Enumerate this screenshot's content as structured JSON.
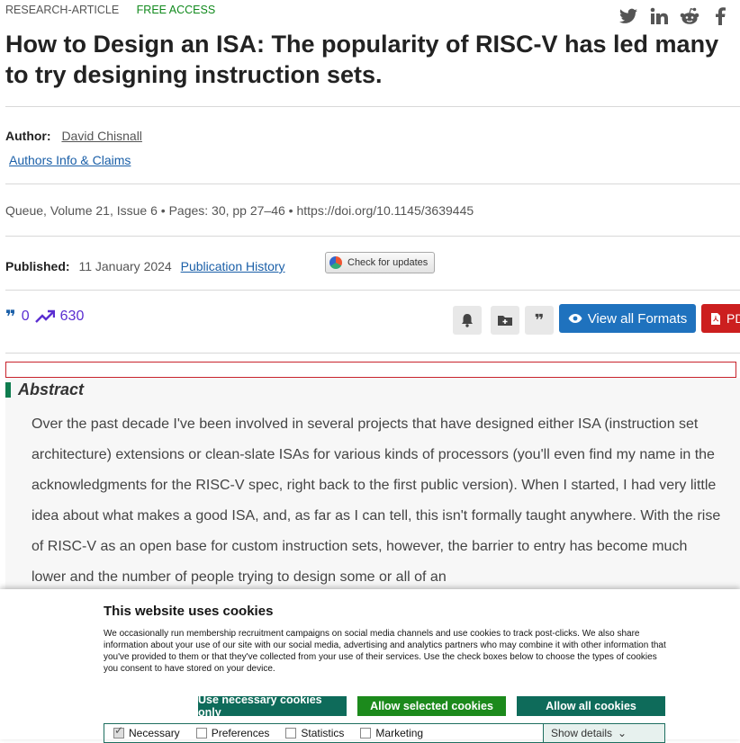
{
  "header": {
    "article_type": "RESEARCH-ARTICLE",
    "access": "FREE ACCESS",
    "share_icons": [
      "twitter-icon",
      "linkedin-icon",
      "reddit-icon",
      "facebook-icon"
    ]
  },
  "article": {
    "title_line1": "How to Design an ISA: The popularity of RISC-V has led many",
    "title_line2": "to try designing instruction sets.",
    "author_label": "Author:",
    "author_name": "David Chisnall",
    "authors_info": "Authors Info & Claims",
    "meta": "Queue, Volume 21, Issue 6 • Pages: 30, pp 27–46 • https://doi.org/10.1145/3639445",
    "published_label": "Published:",
    "published_date": "11 January 2024",
    "publication_history": "Publication History",
    "check_updates": "Check for updates",
    "citations": "0",
    "downloads": "630",
    "view_formats": "View all Formats",
    "pdf": "PDF"
  },
  "abstract": {
    "heading": "Abstract",
    "text": "Over the past decade I've been involved in several projects that have designed either ISA (instruction set architecture) extensions or clean-slate ISAs for various kinds of processors (you'll even find my name in the acknowledgments for the RISC-V spec, right back to the first public version). When I started, I had very little idea about what makes a good ISA, and, as far as I can tell, this isn't formally taught anywhere. With the rise of RISC-V as an open base for custom instruction sets, however, the barrier to entry has become much lower and the number of people trying to design some or all of an"
  },
  "cookie": {
    "title": "This website uses cookies",
    "body": "We occasionally run membership recruitment campaigns on social media channels and use cookies to track post-clicks. We also share information about your use of our site with our social media, advertising and analytics partners who may combine it with other information that you've provided to them or that they've collected from your use of their services. Use the check boxes below to choose the types of cookies you consent to have stored on your device.",
    "btn_necessary": "Use necessary cookies only",
    "btn_selected": "Allow selected cookies",
    "btn_all": "Allow all cookies",
    "opt_necessary": "Necessary",
    "opt_preferences": "Preferences",
    "opt_statistics": "Statistics",
    "opt_marketing": "Marketing",
    "show_details": "Show details",
    "colors": {
      "necessary_btn": "#0e6b5a",
      "selected_btn": "#1c8a1c",
      "all_btn": "#0e6b5a"
    }
  }
}
